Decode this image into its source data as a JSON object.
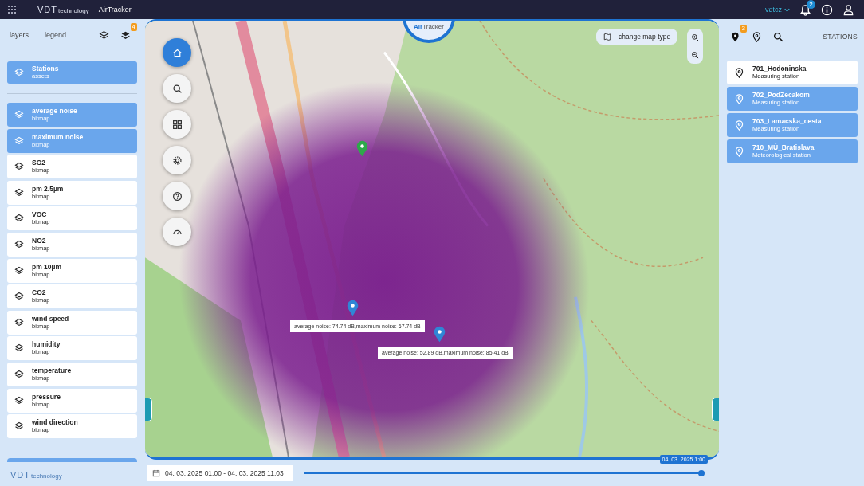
{
  "topbar": {
    "app_name": "AirTracker",
    "logo": "VDT",
    "logo_suffix": "technology",
    "user": "vdtcz",
    "notification_count": "2"
  },
  "left_panel": {
    "tabs": [
      {
        "label": "layers",
        "selected": true
      },
      {
        "label": "legend",
        "selected": false
      }
    ],
    "layers_badge": "4",
    "base_layer": {
      "name": "Stations",
      "type": "assets",
      "on": true
    },
    "layers": [
      {
        "name": "average noise",
        "type": "bitmap",
        "on": true
      },
      {
        "name": "maximum noise",
        "type": "bitmap",
        "on": true
      },
      {
        "name": "SO2",
        "type": "bitmap",
        "on": false
      },
      {
        "name": "pm 2.5µm",
        "type": "bitmap",
        "on": false
      },
      {
        "name": "VOC",
        "type": "bitmap",
        "on": false
      },
      {
        "name": "NO2",
        "type": "bitmap",
        "on": false
      },
      {
        "name": "pm 10µm",
        "type": "bitmap",
        "on": false
      },
      {
        "name": "CO2",
        "type": "bitmap",
        "on": false
      },
      {
        "name": "wind speed",
        "type": "bitmap",
        "on": false
      },
      {
        "name": "humidity",
        "type": "bitmap",
        "on": false
      },
      {
        "name": "temperature",
        "type": "bitmap",
        "on": false
      },
      {
        "name": "pressure",
        "type": "bitmap",
        "on": false
      },
      {
        "name": "wind direction",
        "type": "bitmap",
        "on": false
      }
    ],
    "footer_logo": "VDT",
    "footer_logo_suffix": "technology"
  },
  "map": {
    "brand_first": "Air",
    "brand_second": "Tracker",
    "map_type_button": "change map type",
    "popups": [
      {
        "text": "average noise: 74.74 dB,maximum noise: 67.74 dB"
      },
      {
        "text": "average noise: 52.89 dB,maximum noise: 85.41 dB"
      }
    ]
  },
  "right_panel": {
    "pin_badge": "3",
    "title": "STATIONS",
    "stations": [
      {
        "name": "701_Hodoninska",
        "type": "Measuring station",
        "active": false
      },
      {
        "name": "702_PodZecakom",
        "type": "Measuring station",
        "active": true
      },
      {
        "name": "703_Lamacska_cesta",
        "type": "Measuring station",
        "active": true
      },
      {
        "name": "710_MÚ_Bratislava",
        "type": "Meteorological station",
        "active": true
      }
    ]
  },
  "timeline": {
    "date_range": "04. 03. 2025 01:00 - 04. 03. 2025 11:03",
    "level": 1.0,
    "current": "04. 03. 2025 1:00"
  }
}
